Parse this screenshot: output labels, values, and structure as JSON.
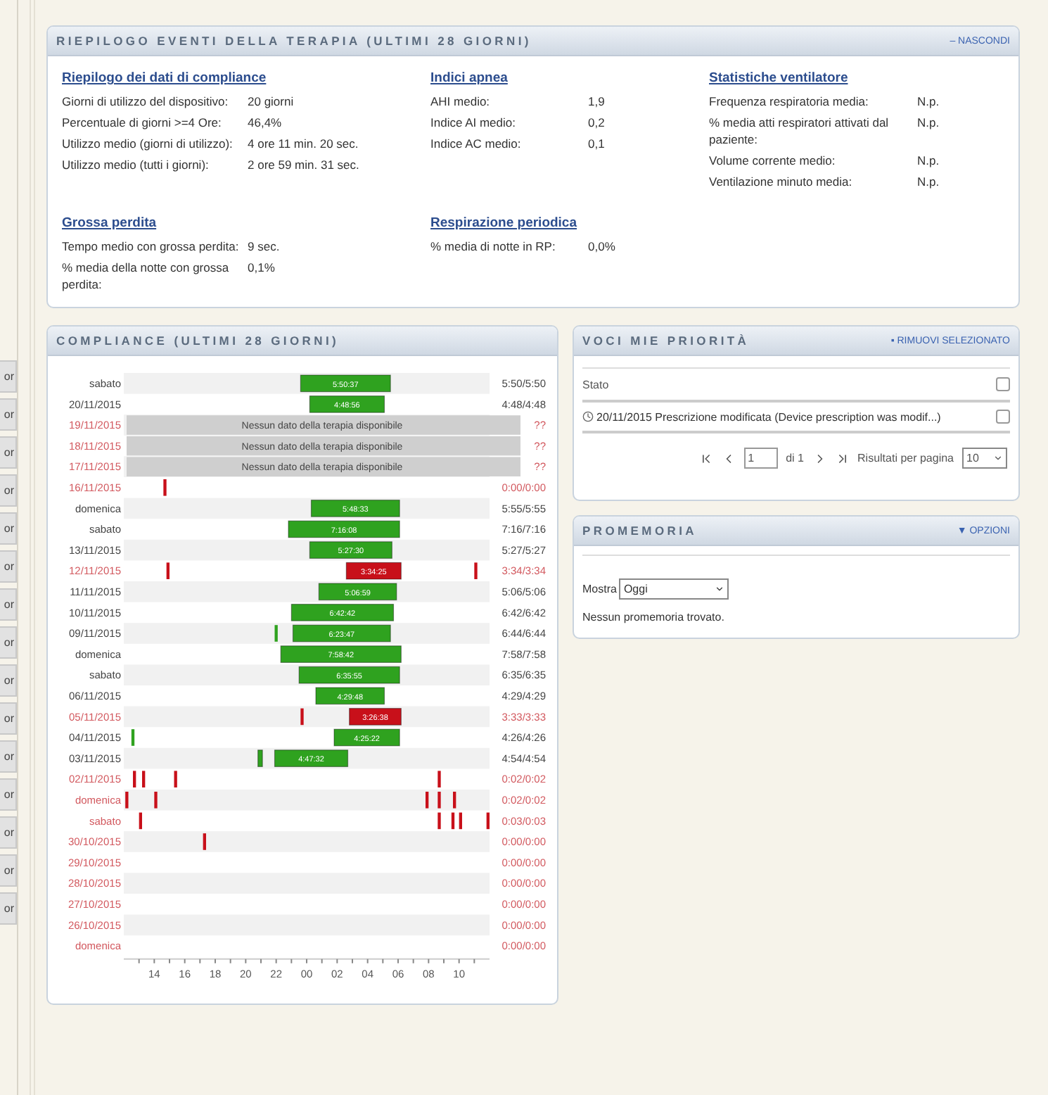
{
  "side_tabs": [
    "or",
    "or",
    "or",
    "or",
    "or",
    "or",
    "or",
    "or",
    "or",
    "or",
    "or",
    "or",
    "or",
    "or",
    "or"
  ],
  "summary": {
    "title": "RIEPILOGO EVENTI DELLA TERAPIA (ULTIMI 28 GIORNI)",
    "toggle": "– NASCONDI",
    "sections": [
      {
        "heading": "Riepilogo dei dati di compliance",
        "items": [
          {
            "label": "Giorni di utilizzo del dispositivo:",
            "value": "20 giorni"
          },
          {
            "label": "Percentuale di giorni >=4 Ore:",
            "value": "46,4%"
          },
          {
            "label": "Utilizzo medio (giorni di utilizzo):",
            "value": "4 ore 11 min. 20 sec."
          },
          {
            "label": "Utilizzo medio (tutti i giorni):",
            "value": "2 ore 59 min. 31 sec."
          }
        ]
      },
      {
        "heading": "Indici apnea",
        "items": [
          {
            "label": "AHI medio:",
            "value": "1,9"
          },
          {
            "label": "Indice AI medio:",
            "value": "0,2"
          },
          {
            "label": "Indice AC medio:",
            "value": "0,1"
          }
        ]
      },
      {
        "heading": "Statistiche ventilatore",
        "items": [
          {
            "label": "Frequenza respiratoria media:",
            "value": "N.p."
          },
          {
            "label": "% media atti respiratori attivati dal paziente:",
            "value": "N.p."
          },
          {
            "label": "Volume corrente medio:",
            "value": "N.p."
          },
          {
            "label": "Ventilazione minuto media:",
            "value": "N.p."
          }
        ]
      },
      {
        "heading": "Grossa perdita",
        "items": [
          {
            "label": "Tempo medio con grossa perdita:",
            "value": "9 sec."
          },
          {
            "label": "% media della notte con grossa perdita:",
            "value": "0,1%"
          }
        ]
      },
      {
        "heading": "Respirazione periodica",
        "items": [
          {
            "label": "% media di notte in RP:",
            "value": "0,0%"
          }
        ]
      }
    ]
  },
  "compliance": {
    "title": "COMPLIANCE (ULTIMI 28 GIORNI)",
    "rows": [
      {
        "total": "5:50/5:50",
        "flagged": false,
        "bar_label": "5:50:37"
      },
      {
        "total": "4:48/4:48",
        "flagged": false,
        "bar_label": "4:48:56"
      },
      {
        "total": "??",
        "flagged": true,
        "note": "Nessun dato della terapia disponibile"
      },
      {
        "total": "??",
        "flagged": true,
        "note": "Nessun dato della terapia disponibile"
      },
      {
        "total": "??",
        "flagged": true,
        "note": "Nessun dato della terapia disponibile"
      },
      {
        "total": "0:00/0:00",
        "flagged": true
      },
      {
        "total": "5:55/5:55",
        "flagged": false,
        "bar_label": "5:48:33"
      },
      {
        "total": "7:16/7:16",
        "flagged": false,
        "bar_label": "7:16:08"
      },
      {
        "total": "5:27/5:27",
        "flagged": false,
        "bar_label": "5:27:30"
      },
      {
        "total": "3:34/3:34",
        "flagged": true,
        "bar_label": "3:34:25"
      },
      {
        "total": "5:06/5:06",
        "flagged": false,
        "bar_label": "5:06:59"
      },
      {
        "total": "6:42/6:42",
        "flagged": false,
        "bar_label": "6:42:42"
      },
      {
        "total": "6:44/6:44",
        "flagged": false,
        "bar_label": "6:23:47"
      },
      {
        "total": "7:58/7:58",
        "flagged": false,
        "bar_label": "7:58:42"
      },
      {
        "total": "6:35/6:35",
        "flagged": false,
        "bar_label": "6:35:55"
      },
      {
        "total": "4:29/4:29",
        "flagged": false,
        "bar_label": "4:29:48"
      },
      {
        "total": "3:33/3:33",
        "flagged": true,
        "bar_label": "3:26:38"
      },
      {
        "total": "4:26/4:26",
        "flagged": false,
        "bar_label": "4:25:22"
      },
      {
        "total": "4:54/4:54",
        "flagged": false,
        "bar_label": "4:47:32"
      },
      {
        "total": "0:02/0:02",
        "flagged": true
      },
      {
        "total": "0:02/0:02",
        "flagged": true
      },
      {
        "total": "0:03/0:03",
        "flagged": true
      },
      {
        "total": "0:00/0:00",
        "flagged": true
      },
      {
        "total": "0:00/0:00",
        "flagged": true
      },
      {
        "total": "0:00/0:00",
        "flagged": true
      },
      {
        "total": "0:00/0:00",
        "flagged": true
      },
      {
        "total": "0:00/0:00",
        "flagged": true
      },
      {
        "total": "0:00/0:00",
        "flagged": true
      }
    ],
    "days": [
      "sabato",
      "20/11/2015",
      "19/11/2015",
      "18/11/2015",
      "17/11/2015",
      "16/11/2015",
      "domenica",
      "sabato",
      "13/11/2015",
      "12/11/2015",
      "11/11/2015",
      "10/11/2015",
      "09/11/2015",
      "domenica",
      "sabato",
      "06/11/2015",
      "05/11/2015",
      "04/11/2015",
      "03/11/2015",
      "02/11/2015",
      "domenica",
      "sabato",
      "30/10/2015",
      "29/10/2015",
      "28/10/2015",
      "27/10/2015",
      "26/10/2015",
      "domenica"
    ],
    "axis_labels": [
      "14",
      "16",
      "18",
      "20",
      "22",
      "00",
      "02",
      "04",
      "06",
      "08",
      "10"
    ]
  },
  "priority": {
    "title": "VOCI MIE PRIORITÀ",
    "action": "▪ RIMUOVI SELEZIONATO",
    "column": "Stato",
    "rows": [
      {
        "text": "20/11/2015 Prescrizione modificata (Device prescription was modif...)",
        "checked": false
      }
    ],
    "header_checked": false,
    "pager": {
      "page": "1",
      "of": "di 1",
      "per_page_label": "Risultati per pagina",
      "per_page": "10"
    }
  },
  "reminders": {
    "title": "PROMEMORIA",
    "action": "▼ OPZIONI",
    "filter_label": "Mostra",
    "filter_value": "Oggi",
    "empty": "Nessun promemoria trovato."
  }
}
